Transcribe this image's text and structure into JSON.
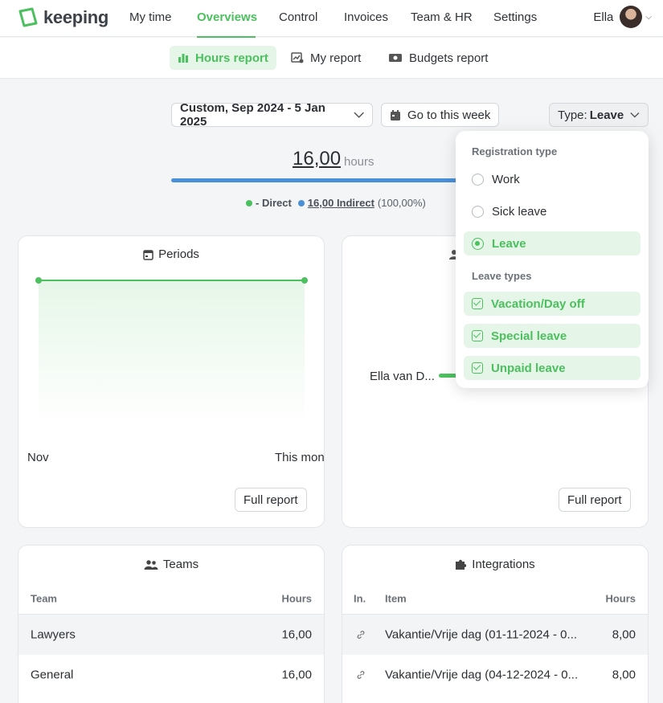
{
  "app": {
    "brand": "keeping"
  },
  "nav": {
    "items": [
      "My time",
      "Overviews",
      "Control",
      "Invoices",
      "Team & HR",
      "Settings"
    ],
    "active": "Overviews",
    "user": "Ella"
  },
  "subnav": {
    "tabs": [
      "Hours report",
      "My report",
      "Budgets report"
    ],
    "active": "Hours report"
  },
  "filters": {
    "period": "Custom, Sep 2024 - 5 Jan 2025",
    "go_week": "Go to this week",
    "type_label": "Type:",
    "type_value": "Leave"
  },
  "summary": {
    "total": "16,00",
    "unit": "hours",
    "direct_label": "- Direct",
    "indirect_label": "16,00 Indirect",
    "indirect_pct": "(100,00%)",
    "direct_color": "#4cc05e",
    "indirect_color": "#4a90d9"
  },
  "periods_card": {
    "title": "Periods",
    "x_start": "Nov",
    "x_end": "This mont",
    "button": "Full report"
  },
  "users_card": {
    "row_label": "Ella van D...",
    "button": "Full report"
  },
  "teams_card": {
    "title": "Teams",
    "col_team": "Team",
    "col_hours": "Hours",
    "rows": [
      {
        "name": "Lawyers",
        "hours": "16,00"
      },
      {
        "name": "General",
        "hours": "16,00"
      }
    ]
  },
  "integrations_card": {
    "title": "Integrations",
    "col_in": "In.",
    "col_item": "Item",
    "col_hours": "Hours",
    "rows": [
      {
        "item": "Vakantie/Vrije dag (01-11-2024 - 0...",
        "hours": "8,00"
      },
      {
        "item": "Vakantie/Vrije dag (04-12-2024 - 0...",
        "hours": "8,00"
      }
    ]
  },
  "dropdown": {
    "reg_title": "Registration type",
    "reg_options": [
      "Work",
      "Sick leave",
      "Leave"
    ],
    "reg_selected": "Leave",
    "leave_title": "Leave types",
    "leave_options": [
      "Vacation/Day off",
      "Special leave",
      "Unpaid leave"
    ]
  },
  "colors": {
    "accent": "#4cc05e",
    "indirect_blue": "#4a90d9"
  }
}
